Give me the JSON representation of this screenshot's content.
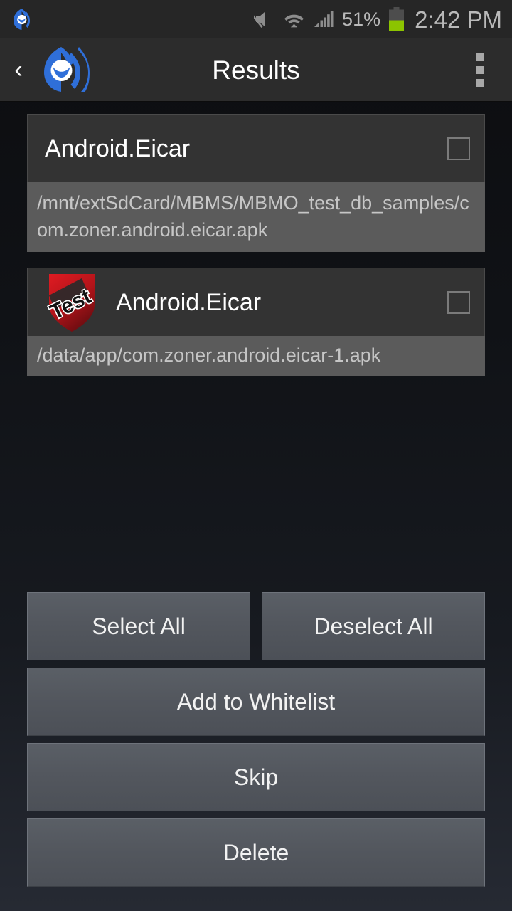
{
  "status_bar": {
    "notification_icon": "app-logo-icon",
    "mute_icon": "mute-icon",
    "wifi_icon": "wifi-icon",
    "signal_icon": "cell-signal-icon",
    "battery_percent": "51%",
    "battery_icon": "battery-icon",
    "clock": "2:42 PM",
    "battery_fill_color": "#8cc400",
    "text_color": "#b9b9b9"
  },
  "app_bar": {
    "back_label": "‹",
    "logo_icon": "malwarebytes-logo-icon",
    "title": "Results",
    "overflow_icon": "overflow-menu-icon",
    "background": "#2c2c2c",
    "brand_color": "#2f6fd9"
  },
  "results": [
    {
      "name": "Android.Eicar",
      "path": "/mnt/extSdCard/MBMS/MBMO_test_db_samples/com.zoner.android.eicar.apk",
      "has_icon": false,
      "icon": "",
      "checked": false,
      "path_lines": 2
    },
    {
      "name": "Android.Eicar",
      "path": "/data/app/com.zoner.android.eicar-1.apk",
      "has_icon": true,
      "icon": "test-shield-icon",
      "icon_label": "Test",
      "checked": false,
      "path_lines": 1
    }
  ],
  "actions": {
    "select_all": "Select All",
    "deselect_all": "Deselect All",
    "add_to_whitelist": "Add to Whitelist",
    "skip": "Skip",
    "delete": "Delete"
  }
}
